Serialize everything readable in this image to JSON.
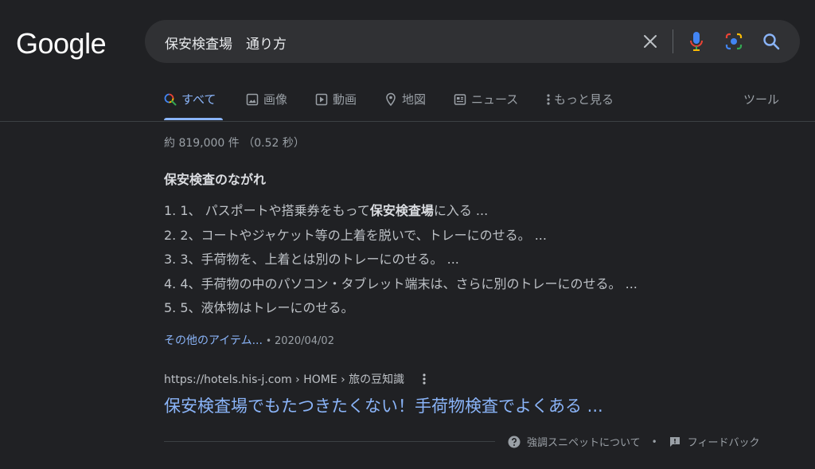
{
  "logo": {
    "text": "Google"
  },
  "search": {
    "query": "保安検査場　通り方"
  },
  "tabs": [
    {
      "label": "すべて",
      "icon": "search-icon"
    },
    {
      "label": "画像",
      "icon": "image-icon"
    },
    {
      "label": "動画",
      "icon": "video-icon"
    },
    {
      "label": "地図",
      "icon": "map-pin-icon"
    },
    {
      "label": "ニュース",
      "icon": "news-icon"
    },
    {
      "label": "もっと見る",
      "icon": "more-vert-icon"
    }
  ],
  "tools_label": "ツール",
  "stats": "約 819,000 件 （0.52 秒）",
  "snippet": {
    "title": "保安検査のながれ",
    "steps": [
      {
        "prefix": "1. 1、 パスポートや搭乗券をもって",
        "bold": "保安検査場",
        "suffix": "に入る ..."
      },
      {
        "prefix": "2. 2、コートやジャケット等の上着を脱いで、トレーにのせる。 ...",
        "bold": "",
        "suffix": ""
      },
      {
        "prefix": "3. 3、手荷物を、上着とは別のトレーにのせる。 ...",
        "bold": "",
        "suffix": ""
      },
      {
        "prefix": "4. 4、手荷物の中のパソコン・タブレット端末は、さらに別のトレーにのせる。 ...",
        "bold": "",
        "suffix": ""
      },
      {
        "prefix": "5. 5、液体物はトレーにのせる。",
        "bold": "",
        "suffix": ""
      }
    ],
    "more_link": "その他のアイテム...",
    "date": "2020/04/02"
  },
  "result": {
    "url": "https://hotels.his-j.com › HOME › 旅の豆知識",
    "title": "保安検査場でもたつきたくない！手荷物検査でよくある ..."
  },
  "footer": {
    "about_label": "強調スニペットについて",
    "feedback_label": "フィードバック"
  },
  "colors": {
    "background": "#202124",
    "link": "#8ab4f8",
    "searchbar": "#303134"
  }
}
